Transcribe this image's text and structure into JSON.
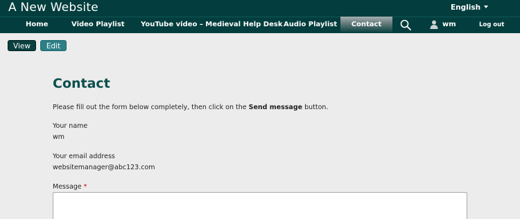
{
  "site": {
    "title": "A New Website"
  },
  "language": {
    "label": "English"
  },
  "nav": {
    "items": [
      {
        "label": "Home"
      },
      {
        "label": "Video Playlist"
      },
      {
        "label": "YouTube video – Medieval Help Desk"
      },
      {
        "label": "Audio Playlist"
      },
      {
        "label": "Contact"
      }
    ]
  },
  "user": {
    "name": "wm",
    "logout": "Log out"
  },
  "tabs": {
    "view": "View",
    "edit": "Edit"
  },
  "page": {
    "title": "Contact",
    "intro_before": "Please fill out the form below completely, then click on the ",
    "intro_bold": "Send message",
    "intro_after": " button."
  },
  "form": {
    "name_label": "Your name",
    "name_value": "wm",
    "email_label": "Your email address",
    "email_value": "websitemanager@abc123.com",
    "message_label": "Message",
    "required_mark": "*",
    "message_value": ""
  },
  "colors": {
    "header_bg": "#033d3d",
    "accent": "#0e4e4e",
    "required": "#cc0000"
  },
  "icons": {
    "search": "search-icon",
    "user": "user-icon",
    "caret": "chevron-down-icon"
  }
}
